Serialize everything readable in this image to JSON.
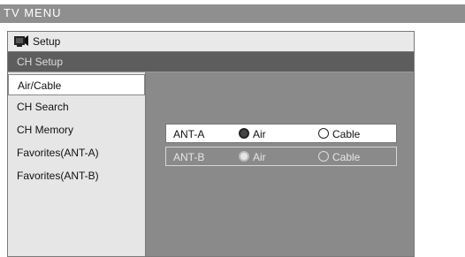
{
  "header": {
    "title": "TV MENU"
  },
  "setup": {
    "label": "Setup",
    "icon": "tv-setup-icon"
  },
  "section": {
    "label": "CH Setup"
  },
  "menu": {
    "items": [
      {
        "label": "Air/Cable"
      },
      {
        "label": "CH Search"
      },
      {
        "label": "CH Memory"
      },
      {
        "label": "Favorites(ANT-A)"
      },
      {
        "label": "Favorites(ANT-B)"
      }
    ],
    "selected": "Air/Cable"
  },
  "antennas": [
    {
      "label": "ANT-A",
      "option1": "Air",
      "option2": "Cable",
      "selected": "Air",
      "enabled": true
    },
    {
      "label": "ANT-B",
      "option1": "Air",
      "option2": "Cable",
      "selected": "Air",
      "enabled": false
    }
  ]
}
